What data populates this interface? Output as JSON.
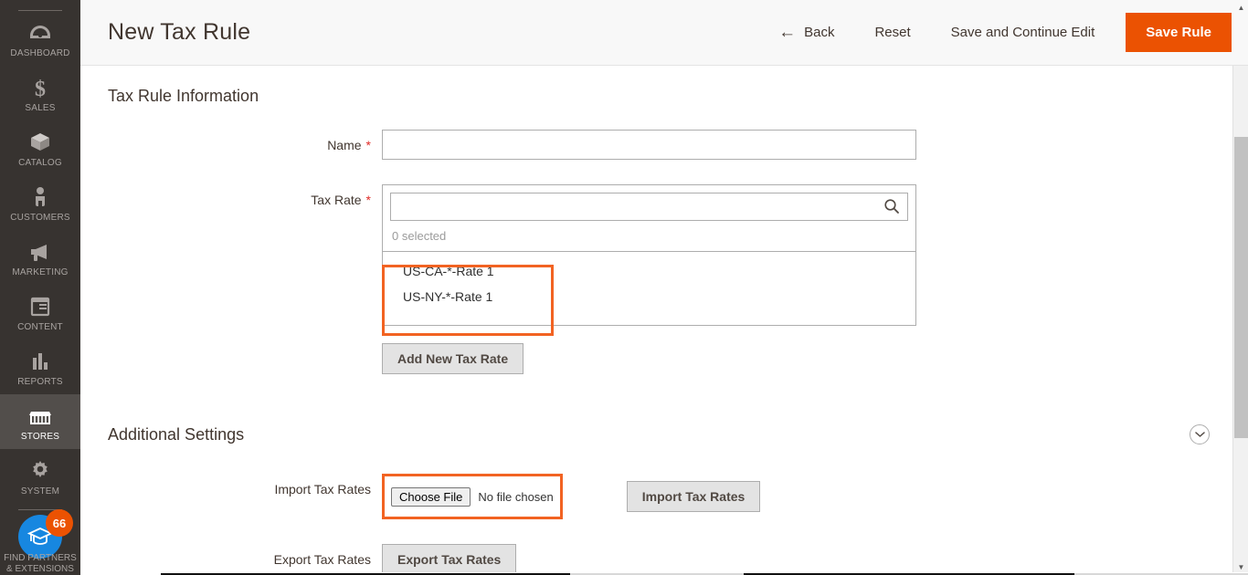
{
  "sidebar": {
    "items": [
      {
        "label": "DASHBOARD",
        "icon": "dashboard-icon",
        "active": false
      },
      {
        "label": "SALES",
        "icon": "dollar-icon",
        "active": false
      },
      {
        "label": "CATALOG",
        "icon": "box-icon",
        "active": false
      },
      {
        "label": "CUSTOMERS",
        "icon": "person-icon",
        "active": false
      },
      {
        "label": "MARKETING",
        "icon": "megaphone-icon",
        "active": false
      },
      {
        "label": "CONTENT",
        "icon": "layout-icon",
        "active": false
      },
      {
        "label": "REPORTS",
        "icon": "bar-chart-icon",
        "active": false
      },
      {
        "label": "STORES",
        "icon": "storefront-icon",
        "active": true
      },
      {
        "label": "SYSTEM",
        "icon": "gear-icon",
        "active": false
      }
    ],
    "partners": {
      "label": "FIND PARTNERS & EXTENSIONS",
      "badge_count": "66",
      "icon": "graduation-cap-icon",
      "badge_color": "#eb5202",
      "circle_color": "#1787e0"
    },
    "background_color": "#373330",
    "active_background_color": "#524e4b"
  },
  "header": {
    "title": "New Tax Rule",
    "back_label": "Back",
    "back_icon": "arrow-left-icon",
    "reset_label": "Reset",
    "save_continue_label": "Save and Continue Edit",
    "save_label": "Save Rule",
    "primary_color": "#eb5202"
  },
  "tax_rule_information": {
    "section_title": "Tax Rule Information",
    "name": {
      "label": "Name",
      "required_marker": "*",
      "value": "",
      "placeholder": ""
    },
    "tax_rate": {
      "label": "Tax Rate",
      "required_marker": "*",
      "search_value": "",
      "search_placeholder": "",
      "search_icon": "search-icon",
      "selected_text": "0 selected",
      "options": [
        "US-CA-*-Rate 1",
        "US-NY-*-Rate 1"
      ]
    },
    "add_new_tax_rate_label": "Add New Tax Rate"
  },
  "additional_settings": {
    "section_title": "Additional Settings",
    "collapse_icon": "chevron-down-icon",
    "import": {
      "label": "Import Tax Rates",
      "choose_file_label": "Choose File",
      "file_status": "No file chosen",
      "button_label": "Import Tax Rates"
    },
    "export": {
      "label": "Export Tax Rates",
      "button_label": "Export Tax Rates"
    }
  },
  "highlights": {
    "color": "#f26322",
    "tax_rate_list": "tax-rate-options-highlight",
    "choose_file": "choose-file-highlight"
  },
  "scrollbar": {
    "up_arrow_icon": "triangle-up-icon",
    "down_arrow_icon": "triangle-down-icon"
  }
}
